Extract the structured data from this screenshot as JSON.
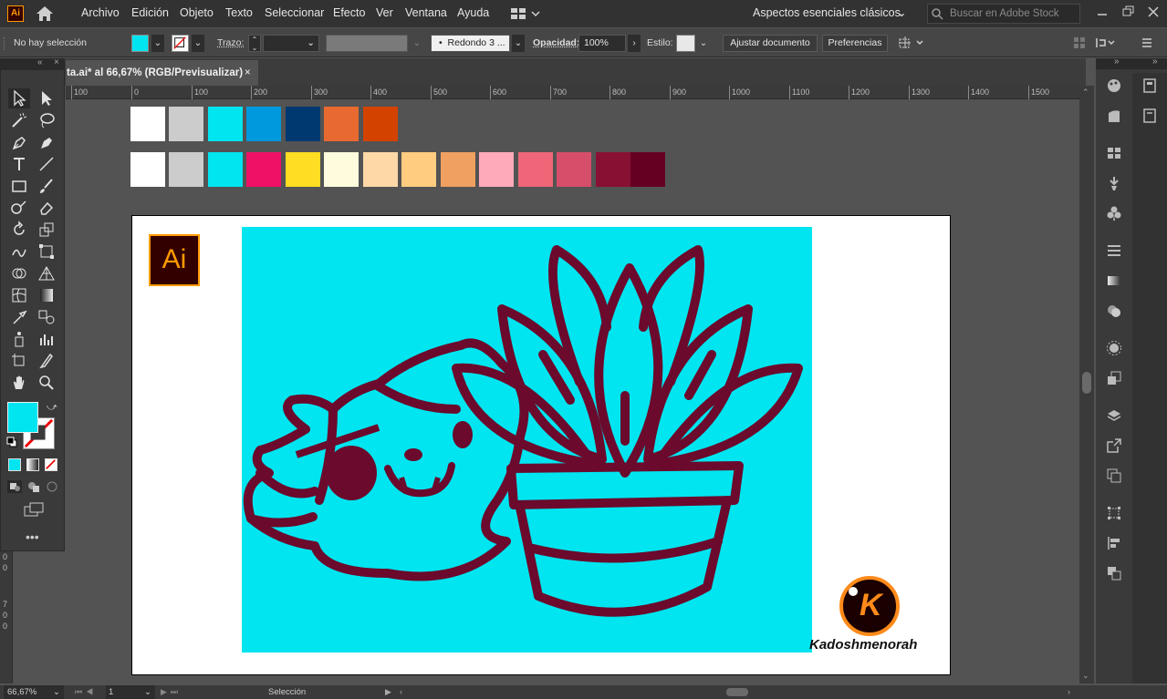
{
  "menubar": {
    "app_icon": "Ai",
    "items": [
      "Archivo",
      "Edición",
      "Objeto",
      "Texto",
      "Seleccionar",
      "Efecto",
      "Ver",
      "Ventana",
      "Ayuda"
    ],
    "workspace": "Aspectos esenciales clásicos",
    "search_placeholder": "Buscar en Adobe Stock"
  },
  "controlbar": {
    "selection_status": "No hay selección",
    "stroke_label": "Trazo:",
    "brush_label": "Redondo 3 ...",
    "opacity_label": "Opacidad:",
    "opacity_value": "100%",
    "style_label": "Estilo:",
    "adjust_button": "Ajustar documento",
    "prefs_button": "Preferencias",
    "fill_color": "#00e5f0"
  },
  "document": {
    "tab_title": "ta.ai* al 66,67% (RGB/Previsualizar)",
    "close_symbol": "×"
  },
  "ruler": {
    "labels": [
      "100",
      "0",
      "100",
      "200",
      "300",
      "400",
      "500",
      "600",
      "700",
      "800",
      "900",
      "1000",
      "1100",
      "1200",
      "1300",
      "1400",
      "1500"
    ],
    "vertical_labels": [
      "0",
      "0",
      "7",
      "0",
      "0"
    ]
  },
  "swatches": {
    "row1": [
      "#ffffff",
      "#cccccc",
      "#00e5f0",
      "#0099dd",
      "#003870",
      "#e86a30",
      "#d44200"
    ],
    "row2": [
      "#ffffff",
      "#cccccc",
      "#00e5f0",
      "#ee1166",
      "#ffdd22",
      "#fffbdd",
      "#ffd8a8",
      "#ffcc80",
      "#f0a060",
      "#ffaabb",
      "#ee6677",
      "#d64e6a",
      "#881133",
      "#660022"
    ]
  },
  "artwork": {
    "background_color": "#00e5f0",
    "outline_color": "#6b0a2c",
    "logo_text": "Ai",
    "watermark_letter": "K",
    "watermark_name": "Kadoshmenorah"
  },
  "statusbar": {
    "zoom": "66,67%",
    "artboard_number": "1",
    "tool_name": "Selección"
  }
}
